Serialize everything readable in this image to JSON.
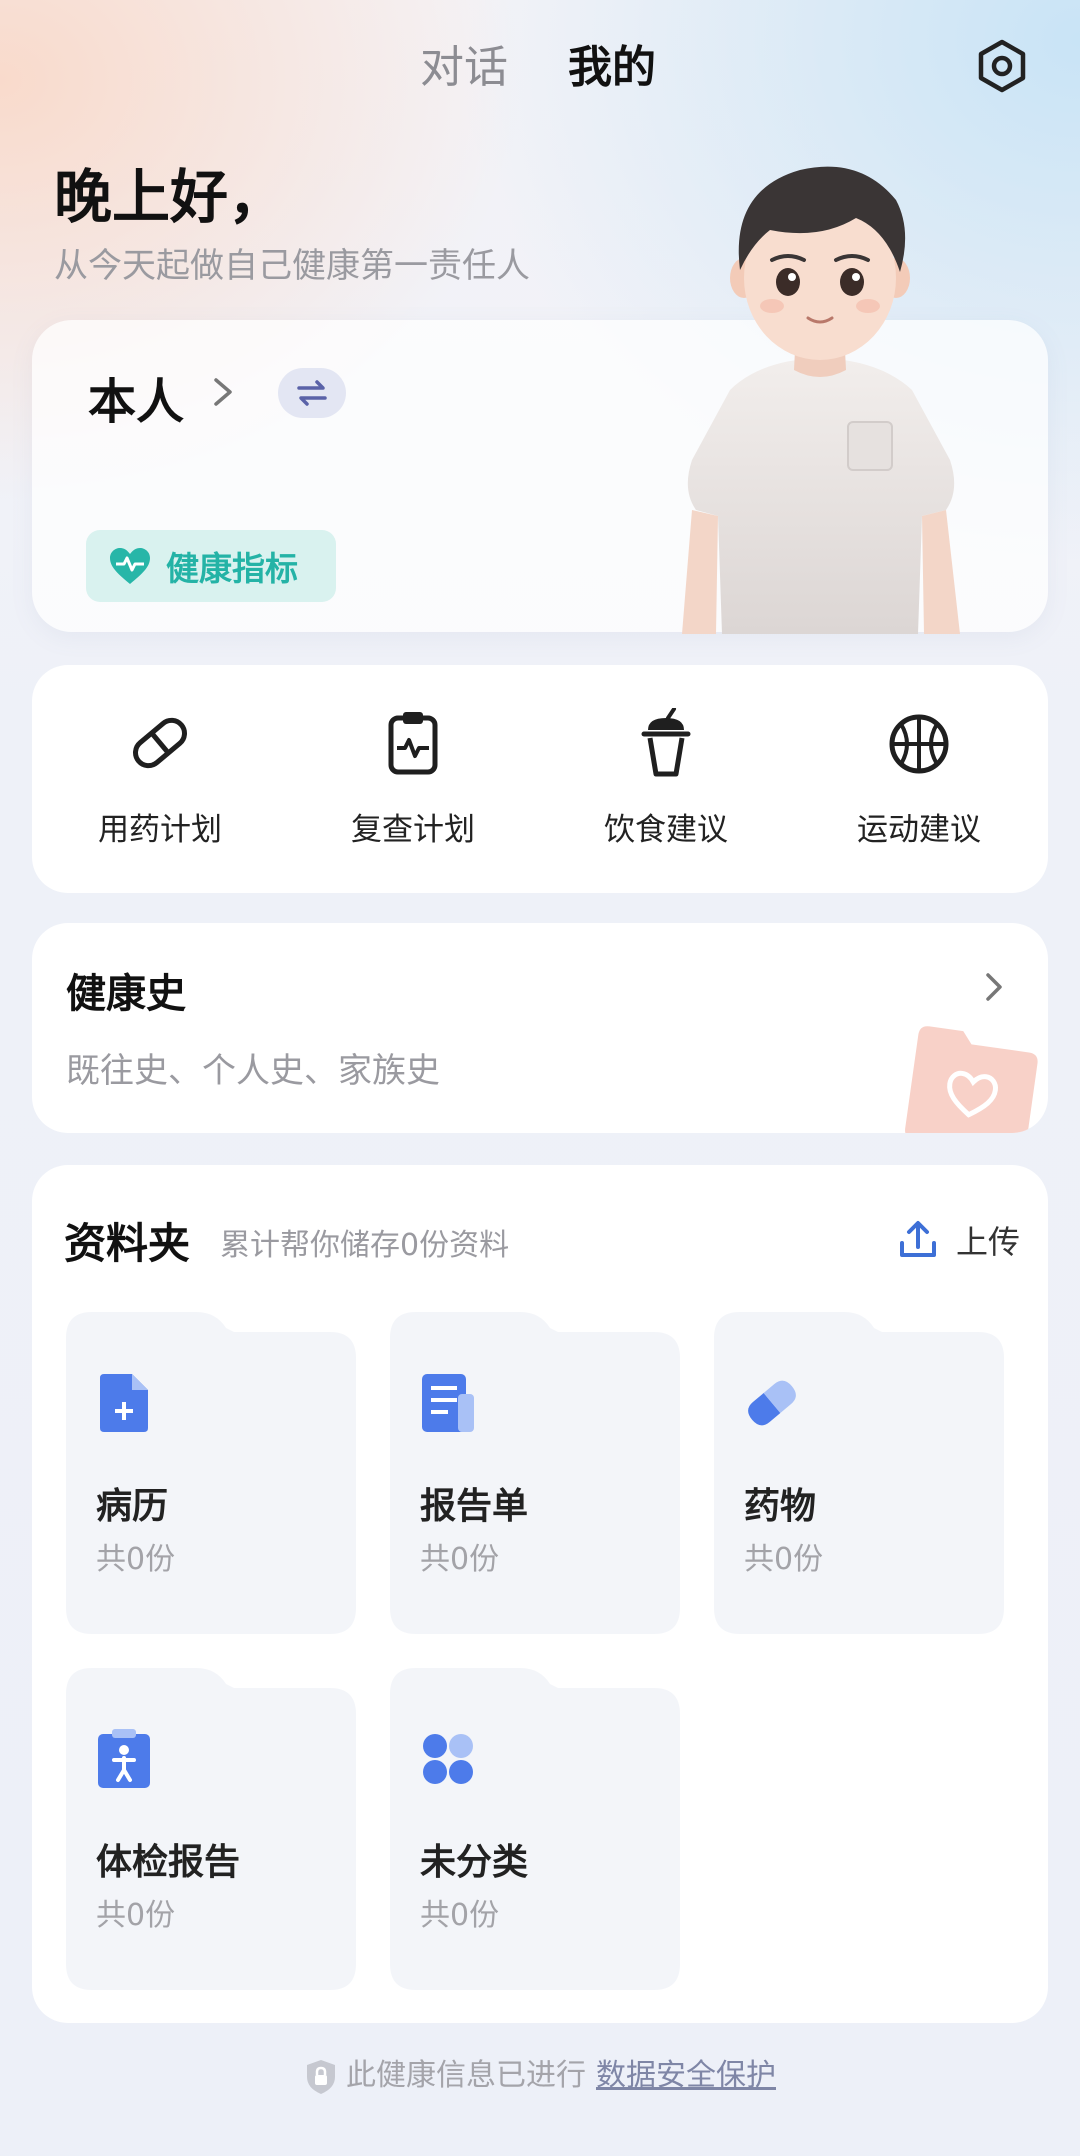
{
  "tabs": {
    "chat": "对话",
    "mine": "我的"
  },
  "greeting": {
    "title": "晚上好，",
    "subtitle": "从今天起做自己健康第一责任人"
  },
  "profile": {
    "name": "本人",
    "health_indicator": "健康指标"
  },
  "quick_actions": [
    {
      "label": "用药计划",
      "icon": "pill-icon"
    },
    {
      "label": "复查计划",
      "icon": "clipboard-pulse-icon"
    },
    {
      "label": "饮食建议",
      "icon": "drink-cup-icon"
    },
    {
      "label": "运动建议",
      "icon": "basketball-icon"
    }
  ],
  "health_history": {
    "title": "健康史",
    "desc": "既往史、个人史、家族史"
  },
  "folder_section": {
    "title": "资料夹",
    "count_text": "累计帮你储存0份资料",
    "upload_label": "上传",
    "folders": [
      {
        "name": "病历",
        "count": "共0份",
        "icon": "medical-record-icon"
      },
      {
        "name": "报告单",
        "count": "共0份",
        "icon": "report-icon"
      },
      {
        "name": "药物",
        "count": "共0份",
        "icon": "capsule-icon"
      },
      {
        "name": "体检报告",
        "count": "共0份",
        "icon": "checkup-icon"
      },
      {
        "name": "未分类",
        "count": "共0份",
        "icon": "grid-icon"
      }
    ]
  },
  "footer": {
    "text": "此健康信息已进行",
    "link": "数据安全保护"
  },
  "colors": {
    "accent_teal": "#24b3a6",
    "icon_blue": "#4d7bea",
    "folder_bg": "#f3f5f9"
  }
}
